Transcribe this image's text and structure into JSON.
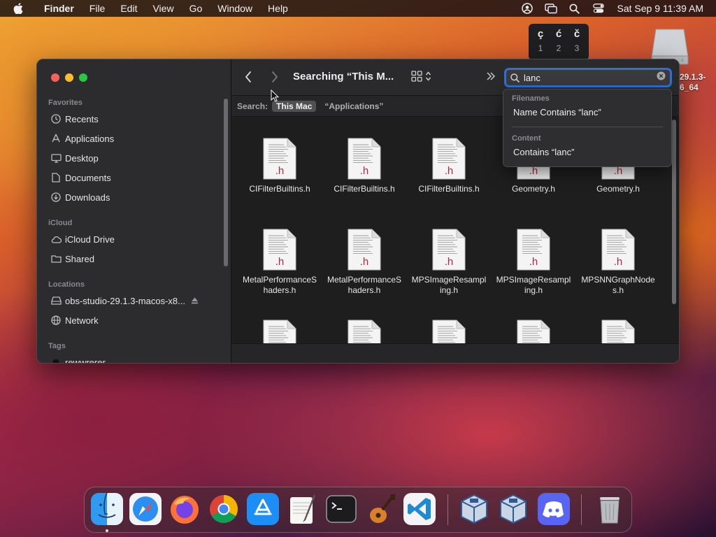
{
  "menubar": {
    "app_name": "Finder",
    "menus": [
      "File",
      "Edit",
      "View",
      "Go",
      "Window",
      "Help"
    ],
    "clock": "Sat Sep 9  11:39 AM"
  },
  "ime": {
    "candidates": [
      {
        "char": "ç",
        "num": "1"
      },
      {
        "char": "ć",
        "num": "2"
      },
      {
        "char": "č",
        "num": "3"
      }
    ]
  },
  "desktop": {
    "drive_label": "29.1.3-\n6_64"
  },
  "finder": {
    "title": "Searching “This M...",
    "search": {
      "value": "lanc"
    },
    "scope": {
      "label": "Search:",
      "active": "This Mac",
      "inactive": "“Applications”"
    },
    "sidebar": {
      "favorites_label": "Favorites",
      "favorites": [
        "Recents",
        "Applications",
        "Desktop",
        "Documents",
        "Downloads"
      ],
      "icloud_label": "iCloud",
      "icloud": [
        "iCloud Drive",
        "Shared"
      ],
      "locations_label": "Locations",
      "locations": [
        "obs-studio-29.1.3-macos-x8...",
        "Network"
      ],
      "tags_label": "Tags",
      "tags": [
        "rewwrerer"
      ]
    },
    "files": [
      "CIFilterBuiltins.h",
      "CIFilterBuiltins.h",
      "CIFilterBuiltins.h",
      "Geometry.h",
      "Geometry.h",
      "MetalPerformanceShaders.h",
      "MetalPerformanceShaders.h",
      "MPSImageResampling.h",
      "MPSImageResampling.h",
      "MPSNNGraphNodes.h",
      "",
      "",
      "",
      "",
      ""
    ],
    "file_badge": ".h"
  },
  "suggestions": {
    "filenames_head": "Filenames",
    "filenames_item": "Name Contains “lanc”",
    "content_head": "Content",
    "content_item": "Contains “lanc”"
  },
  "colors": {
    "accent": "#2f6fd8",
    "file_badge": "#b0283a"
  }
}
